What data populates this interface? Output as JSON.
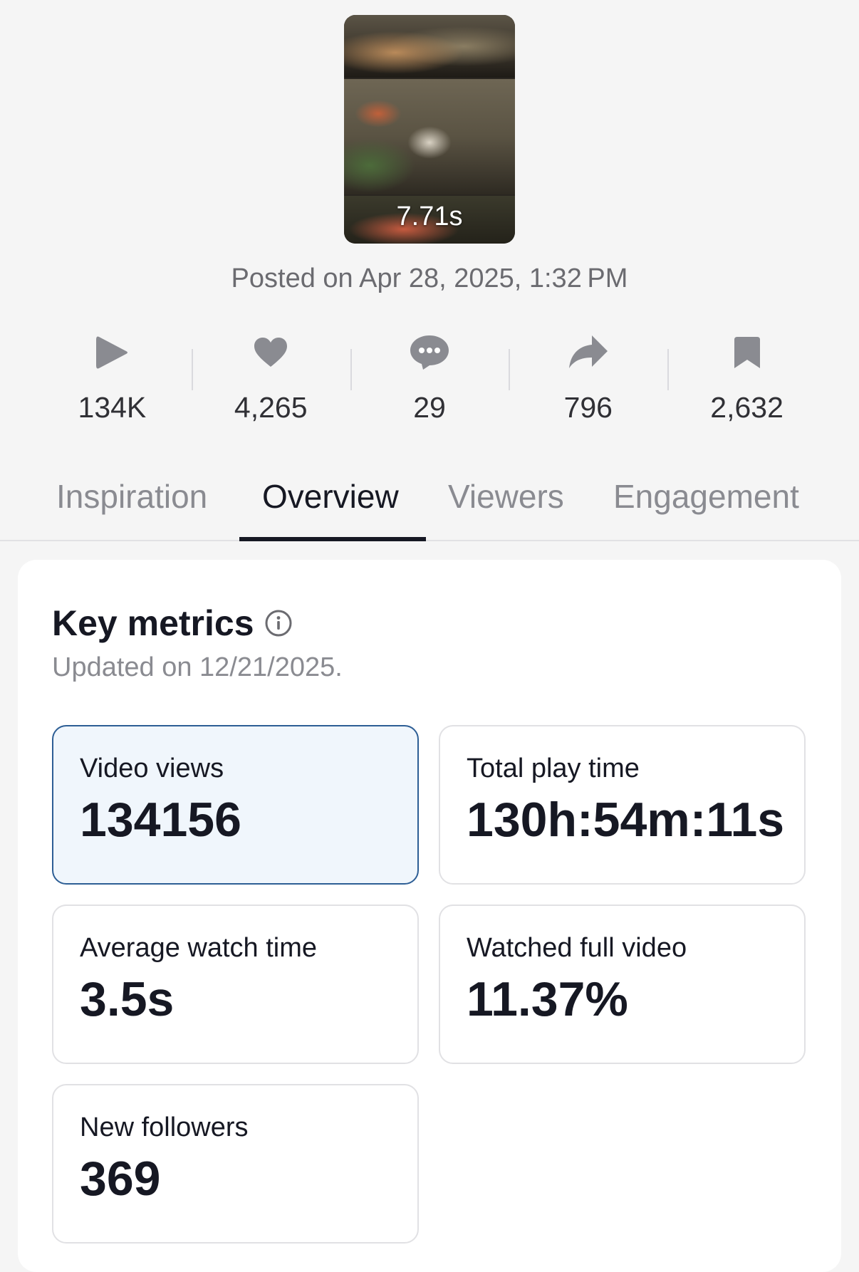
{
  "video": {
    "duration": "7.71s",
    "posted": "Posted on Apr 28, 2025, 1:32 PM"
  },
  "stats": [
    {
      "icon": "play-icon",
      "value": "134K"
    },
    {
      "icon": "heart-icon",
      "value": "4,265"
    },
    {
      "icon": "comment-icon",
      "value": "29"
    },
    {
      "icon": "share-icon",
      "value": "796"
    },
    {
      "icon": "bookmark-icon",
      "value": "2,632"
    }
  ],
  "tabs": [
    {
      "label": "Inspiration",
      "active": false
    },
    {
      "label": "Overview",
      "active": true
    },
    {
      "label": "Viewers",
      "active": false
    },
    {
      "label": "Engagement",
      "active": false
    }
  ],
  "key_metrics": {
    "title": "Key metrics",
    "updated": "Updated on 12/21/2025.",
    "cards": [
      {
        "label": "Video views",
        "value": "134156",
        "selected": true
      },
      {
        "label": "Total play time",
        "value": "130h:54m:11s",
        "selected": false
      },
      {
        "label": "Average watch time",
        "value": "3.5s",
        "selected": false
      },
      {
        "label": "Watched full video",
        "value": "11.37%",
        "selected": false
      },
      {
        "label": "New followers",
        "value": "369",
        "selected": false
      }
    ]
  },
  "colors": {
    "background": "#f5f5f5",
    "text": "#161823",
    "muted": "#8a8b91",
    "icon": "#8a8b91",
    "selected_border": "#2d5e95",
    "selected_bg": "#f0f6fc"
  }
}
